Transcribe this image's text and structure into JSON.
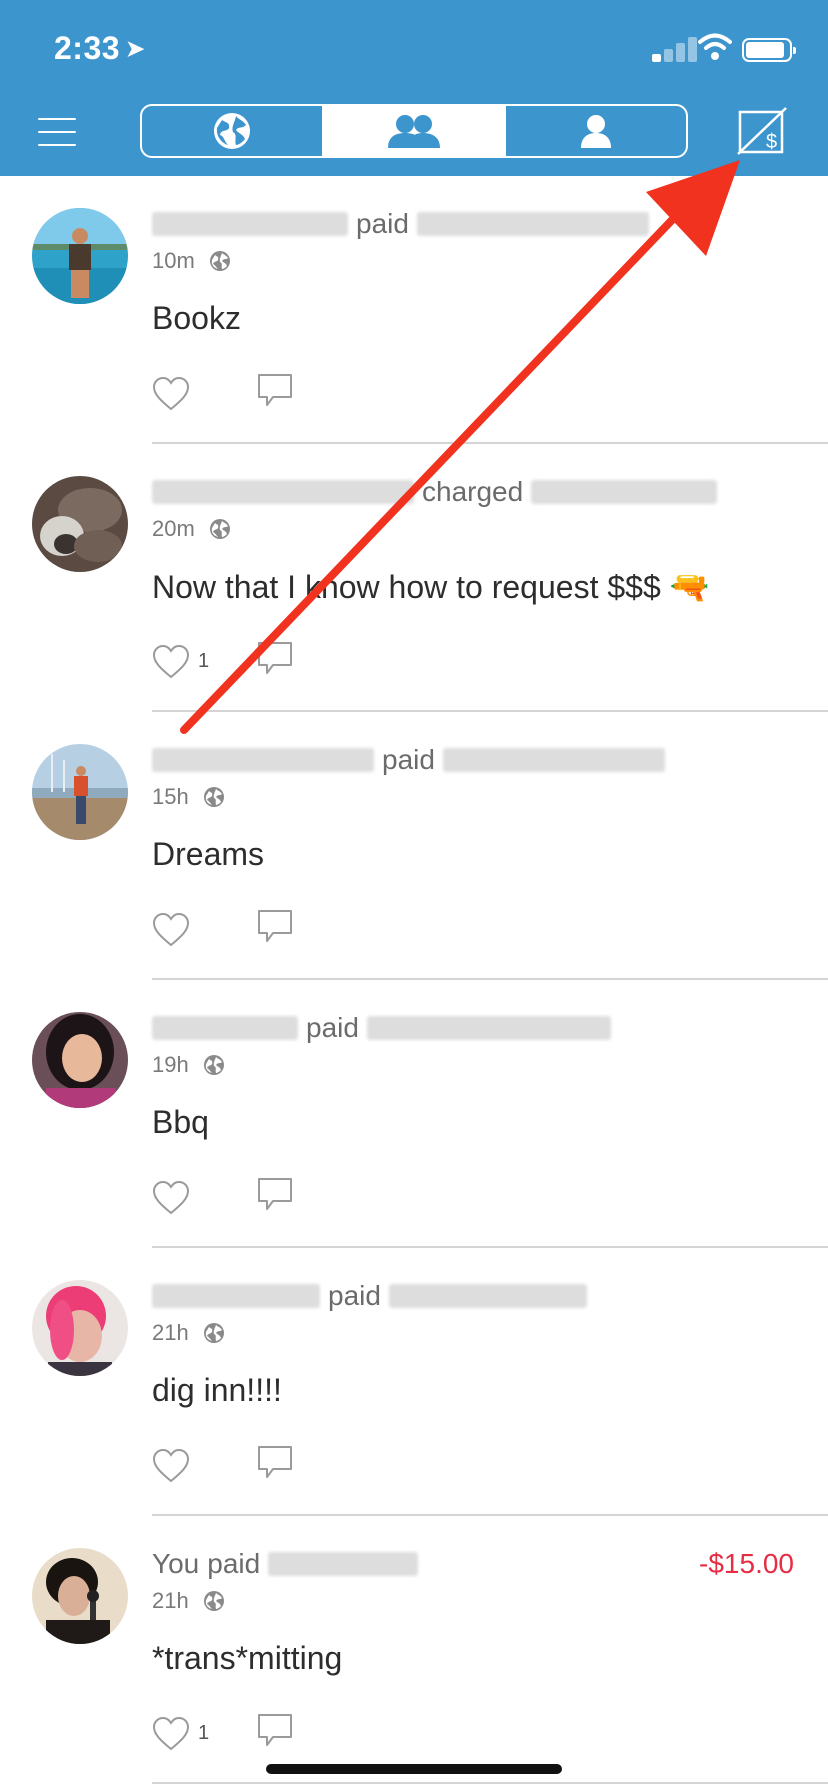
{
  "status_bar": {
    "time": "2:33",
    "location_glyph": "➤"
  },
  "header": {
    "menu_icon": "hamburger-menu-icon",
    "tabs": [
      {
        "icon": "globe-icon",
        "active": false
      },
      {
        "icon": "friends-icon",
        "active": true
      },
      {
        "icon": "person-icon",
        "active": false
      }
    ],
    "pay_icon": "pay-request-icon"
  },
  "feed": [
    {
      "actor_blur": true,
      "verb": "paid",
      "target_blur": true,
      "time": "10m",
      "note": "Bookz",
      "likes": ""
    },
    {
      "actor_blur": true,
      "verb": "charged",
      "target_blur": true,
      "time": "20m",
      "note": "Now that I know how to request $$$ 🔫",
      "likes": "1"
    },
    {
      "actor_blur": true,
      "verb": "paid",
      "target_blur": true,
      "time": "15h",
      "note": "Dreams",
      "likes": ""
    },
    {
      "actor_blur": true,
      "verb": "paid",
      "target_blur": true,
      "time": "19h",
      "note": "Bbq",
      "likes": ""
    },
    {
      "actor_blur": true,
      "verb": "paid",
      "target_blur": true,
      "time": "21h",
      "note": "dig inn!!!!",
      "likes": ""
    },
    {
      "actor": "You",
      "verb": "paid",
      "target_blur": true,
      "time": "21h",
      "note": "*trans*mitting",
      "likes": "1",
      "amount": "-$15.00"
    }
  ],
  "colors": {
    "header": "#3d95ce",
    "negative_amount": "#e52d44",
    "annotation_arrow": "#f0321e"
  }
}
